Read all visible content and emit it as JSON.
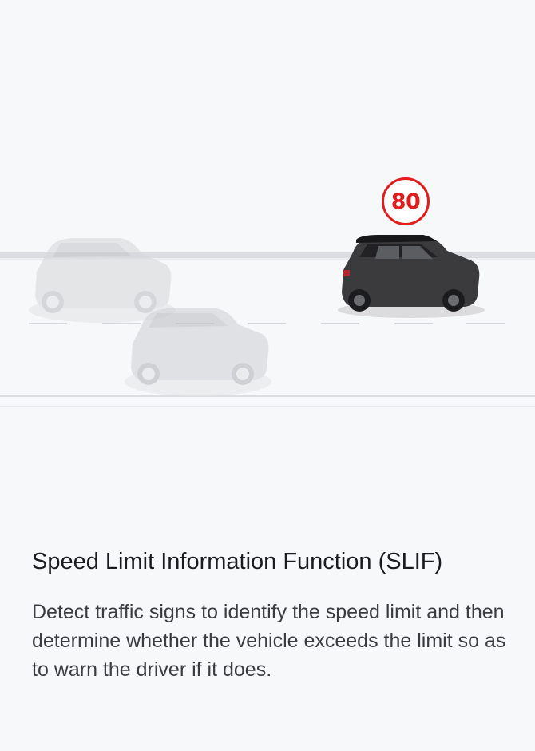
{
  "illustration": {
    "speed_limit_sign": {
      "value": "80",
      "color": "#e21d1d"
    },
    "vehicle_color": "#3b3b3e",
    "ghost_vehicle_color": "#d5d6d9"
  },
  "feature": {
    "title": "Speed Limit Information Function (SLIF)",
    "description": "Detect traffic signs to identify the speed limit and then determine whether the vehicle exceeds the limit so as to warn the driver if it does."
  }
}
